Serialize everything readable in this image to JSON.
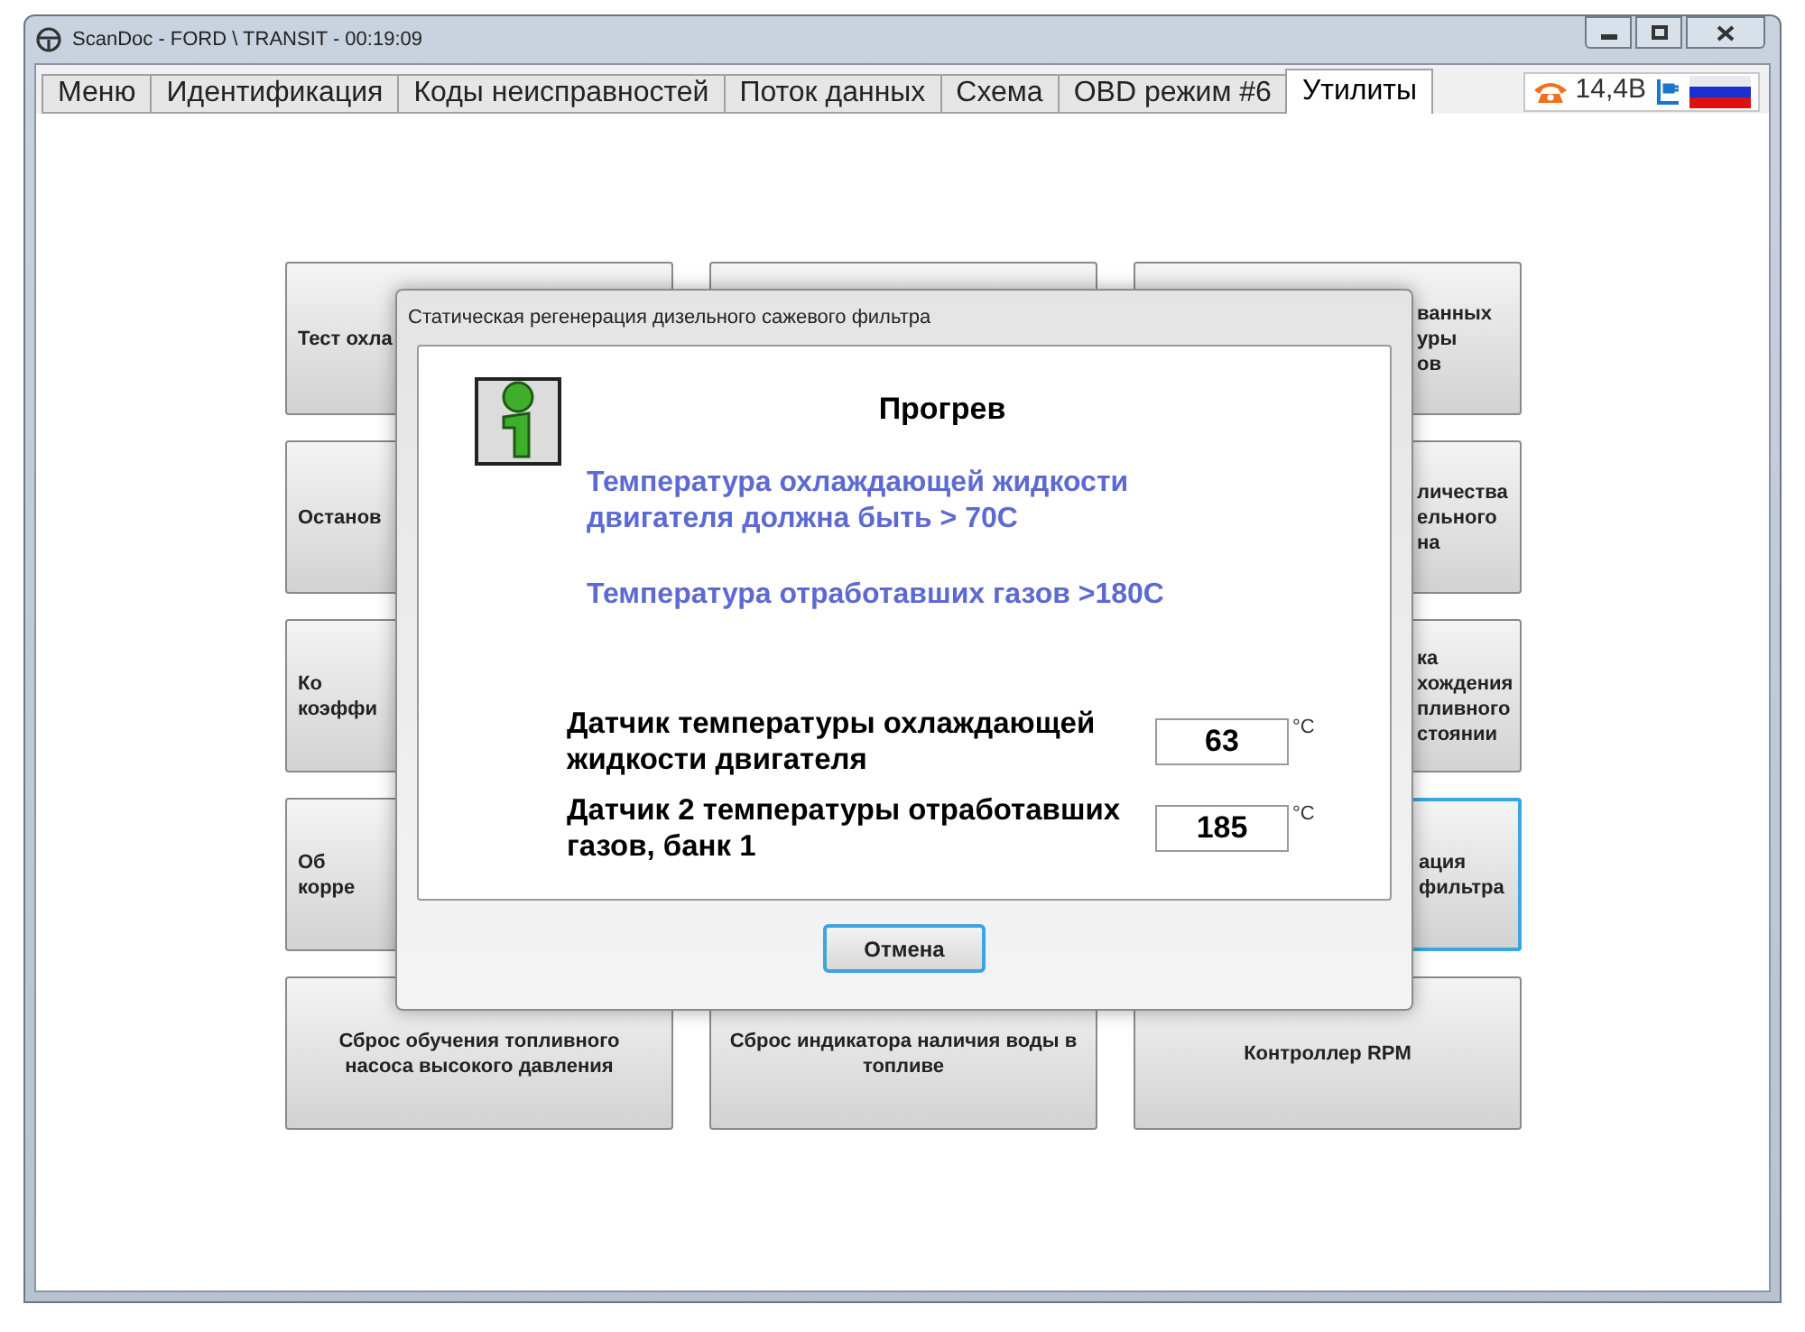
{
  "window": {
    "title": "ScanDoc - FORD \\ TRANSIT - 00:19:09"
  },
  "tabs": [
    {
      "label": "Меню",
      "selected": false
    },
    {
      "label": "Идентификация",
      "selected": false
    },
    {
      "label": "Коды неисправностей",
      "selected": false
    },
    {
      "label": "Поток данных",
      "selected": false
    },
    {
      "label": "Схема",
      "selected": false
    },
    {
      "label": "OBD режим #6",
      "selected": false
    },
    {
      "label": "Утилиты",
      "selected": true
    }
  ],
  "status": {
    "voltage": "14,4В"
  },
  "grid": [
    {
      "kind": "left",
      "focused": false,
      "lines": [
        "Тест охла"
      ]
    },
    {
      "kind": "middle",
      "focused": false
    },
    {
      "kind": "right",
      "focused": false,
      "lines": [
        "ванных",
        "уры",
        "ов"
      ]
    },
    {
      "kind": "left",
      "focused": false,
      "lines": [
        "Останов"
      ]
    },
    {
      "kind": "hidden"
    },
    {
      "kind": "right",
      "focused": false,
      "lines": [
        "личества",
        "ельного",
        "на"
      ]
    },
    {
      "kind": "left",
      "focused": false,
      "lines": [
        "Ко",
        "коэффи"
      ]
    },
    {
      "kind": "hidden"
    },
    {
      "kind": "right",
      "focused": false,
      "lines": [
        "ка",
        "хождения",
        "пливного",
        "стоянии"
      ]
    },
    {
      "kind": "left",
      "focused": false,
      "lines": [
        "Об",
        "корре"
      ]
    },
    {
      "kind": "hidden"
    },
    {
      "kind": "right",
      "focused": true,
      "lines": [
        "ация",
        "фильтра"
      ]
    },
    {
      "kind": "full",
      "focused": false,
      "lines": [
        "Сброс обучения топливного",
        "насоса высокого давления"
      ]
    },
    {
      "kind": "full",
      "focused": false,
      "lines": [
        "Сброс индикатора наличия воды в",
        "топливе"
      ]
    },
    {
      "kind": "full",
      "focused": false,
      "lines": [
        "Контроллер RPM"
      ]
    }
  ],
  "dialog": {
    "title": "Статическая регенерация дизельного сажевого фильтра",
    "heading": "Прогрев",
    "notes": [
      "Температура охлаждающей жидкости двигателя должна быть > 70С",
      "Температура отработавших газов >180С"
    ],
    "sensors": [
      {
        "label": "Датчик температуры охлаждающей жидкости двигателя",
        "value": "63",
        "unit": "°C"
      },
      {
        "label": "Датчик 2 температуры отработавших газов, банк 1",
        "value": "185",
        "unit": "°C"
      }
    ],
    "cancel_button": "Отмена"
  }
}
